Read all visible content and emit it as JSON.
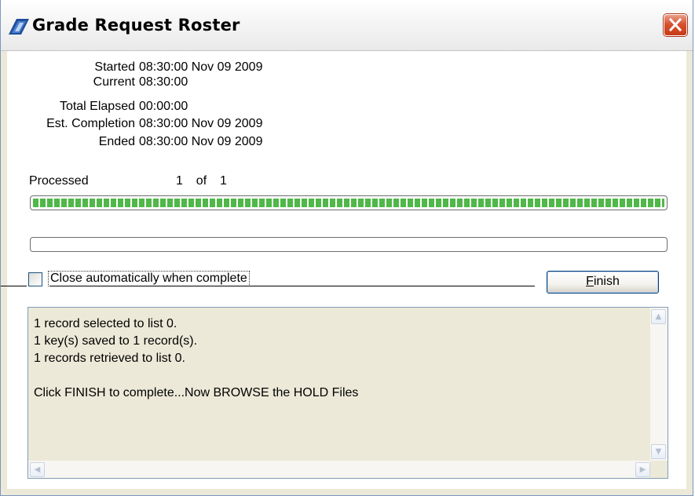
{
  "window": {
    "title": "Grade Request Roster"
  },
  "times": {
    "started_label": "Started",
    "started_value": "08:30:00 Nov 09 2009",
    "current_label": "Current",
    "current_value": "08:30:00",
    "elapsed_label": "Total Elapsed",
    "elapsed_value": "00:00:00",
    "completion_label": "Est. Completion",
    "completion_value": "08:30:00 Nov 09 2009",
    "ended_label": "Ended",
    "ended_value": "08:30:00 Nov 09 2009"
  },
  "progress": {
    "processed_label": "Processed",
    "processed_count": "1  of  1",
    "main_fraction": 1.0,
    "secondary_fraction": 0.0,
    "fill_color": "#4fb848"
  },
  "options": {
    "auto_close_label": "Close automatically when complete",
    "auto_close_checked": false
  },
  "buttons": {
    "finish_mnemonic": "F",
    "finish_rest": "inish"
  },
  "log": {
    "lines": [
      "1 record selected to list 0.",
      "1 key(s) saved to 1 record(s).",
      "1 records retrieved to list 0.",
      "",
      "Click FINISH to complete...Now BROWSE the HOLD Files"
    ]
  },
  "icons": {
    "app": "app-logo-icon",
    "close": "close-icon",
    "scroll_up": "chevron-up-icon",
    "scroll_down": "chevron-down-icon",
    "scroll_left": "chevron-left-icon",
    "scroll_right": "chevron-right-icon"
  }
}
